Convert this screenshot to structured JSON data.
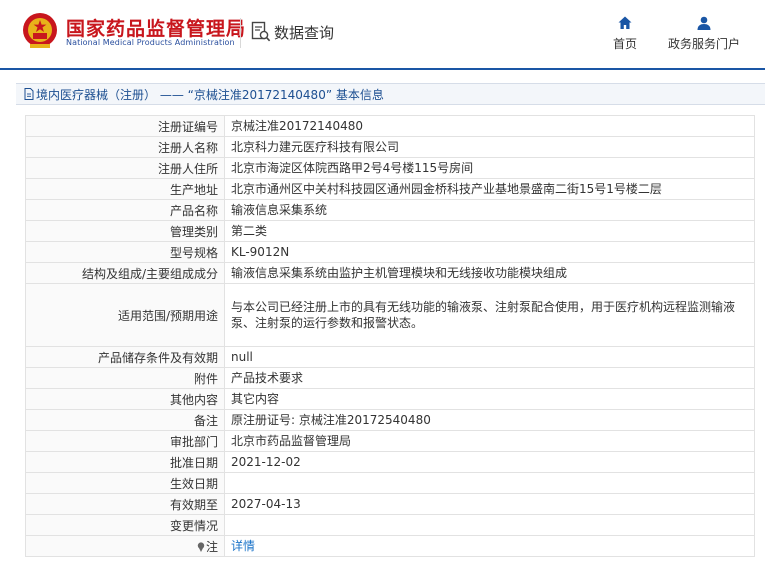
{
  "header": {
    "org_name_cn": "国家药品监督管理局",
    "org_name_en": "National Medical Products Administration",
    "query_label": "数据查询",
    "nav": [
      {
        "label": "首页",
        "icon": "home-icon"
      },
      {
        "label": "政务服务门户",
        "icon": "user-icon"
      }
    ]
  },
  "breadcrumb": "境内医疗器械（注册） —— “京械注准20172140480” 基本信息",
  "colors": {
    "brand_red": "#c8161d",
    "brand_blue": "#1a56a5",
    "link": "#1a73c8"
  },
  "rows": [
    {
      "key": "注册证编号",
      "value": "京械注准20172140480"
    },
    {
      "key": "注册人名称",
      "value": "北京科力建元医疗科技有限公司"
    },
    {
      "key": "注册人住所",
      "value": "北京市海淀区体院西路甲2号4号楼115号房间"
    },
    {
      "key": "生产地址",
      "value": "北京市通州区中关村科技园区通州园金桥科技产业基地景盛南二街15号1号楼二层"
    },
    {
      "key": "产品名称",
      "value": "输液信息采集系统"
    },
    {
      "key": "管理类别",
      "value": "第二类"
    },
    {
      "key": "型号规格",
      "value": "KL-9012N"
    },
    {
      "key": "结构及组成/主要组成成分",
      "value": "输液信息采集系统由监护主机管理模块和无线接收功能模块组成"
    },
    {
      "key": "适用范围/预期用途",
      "value": "与本公司已经注册上市的具有无线功能的输液泵、注射泵配合使用，用于医疗机构远程监测输液泵、注射泵的运行参数和报警状态。"
    },
    {
      "key": "产品储存条件及有效期",
      "value": "null"
    },
    {
      "key": "附件",
      "value": "产品技术要求"
    },
    {
      "key": "其他内容",
      "value": "其它内容"
    },
    {
      "key": "备注",
      "value": "原注册证号: 京械注准20172540480"
    },
    {
      "key": "审批部门",
      "value": "北京市药品监督管理局"
    },
    {
      "key": "批准日期",
      "value": "2021-12-02"
    },
    {
      "key": "生效日期",
      "value": ""
    },
    {
      "key": "有效期至",
      "value": "2027-04-13"
    },
    {
      "key": "变更情况",
      "value": ""
    },
    {
      "key": "注",
      "value": "详情"
    }
  ]
}
